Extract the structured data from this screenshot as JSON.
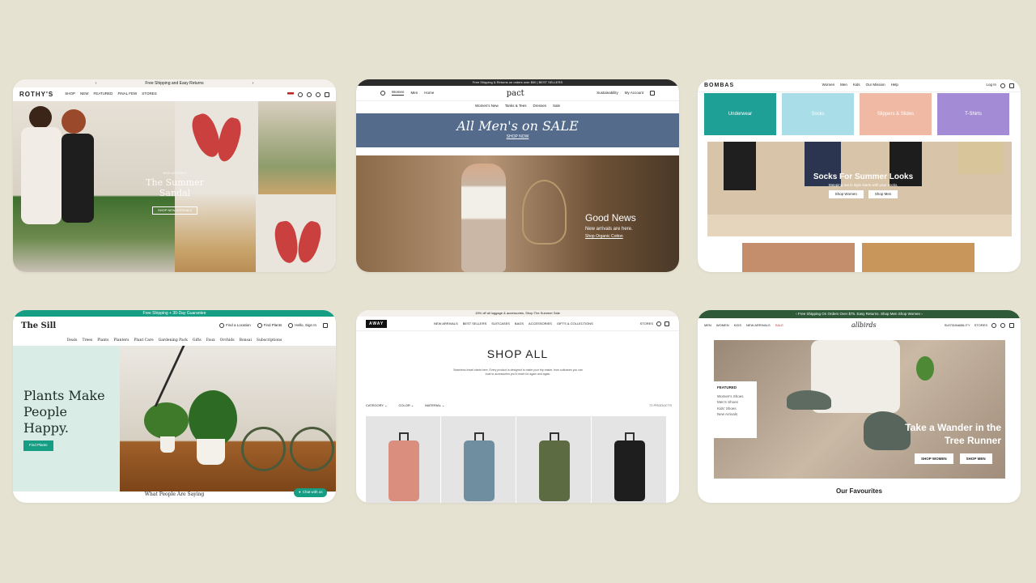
{
  "rothys": {
    "promo": "Free Shipping and Easy Returns",
    "logo": "ROTHY'S",
    "nav": [
      "SHOP",
      "NEW",
      "FEATURED",
      "FINAL FEW",
      "STORES"
    ],
    "eyebrow": "NEW ARRIVALS",
    "title": "The Summer Sandal",
    "cta": "SHOP NEW ARRIVALS"
  },
  "pact": {
    "promo": "Free Shipping & Returns on orders over $50 | BEST SELLERS",
    "logo": "pact",
    "nav": [
      "Women",
      "Men",
      "Home"
    ],
    "nav_right": [
      "Sustainability",
      "My Account"
    ],
    "subnav": [
      "Women's New",
      "Tanks & Tees",
      "Dresses",
      "Sale"
    ],
    "sale_title": "All Men's on SALE",
    "sale_cta": "SHOP NOW",
    "hero_title": "Good News",
    "hero_text": "New arrivals are here.",
    "hero_cta": "Shop Organic Cotton"
  },
  "bombas": {
    "logo": "BOMBAS",
    "nav": [
      "Women",
      "Men",
      "Kids",
      "Our Mission",
      "Help"
    ],
    "login": "Log In",
    "tiles": [
      "Underwear",
      "Socks",
      "Slippers & Slides",
      "T-Shirts"
    ],
    "hero_title": "Socks For Summer Looks",
    "hero_text": "Stepping out in style starts with your socks.",
    "btn_women": "Shop Women",
    "btn_men": "Shop Men"
  },
  "sill": {
    "promo": "Free Shipping + 30-Day Guarantee",
    "logo": "The Sill",
    "nav_right": [
      "Find a Location",
      "Find Plants",
      "Hello, Sign In"
    ],
    "subnav": [
      "Deals",
      "Trees",
      "Plants",
      "Planters",
      "Plant Care",
      "Gardening Pack",
      "Gifts",
      "Faux",
      "Orchids",
      "Bonsai",
      "Subscriptions"
    ],
    "headline": "Plants Make People Happy.",
    "cta": "Find Plants",
    "footer": "What People Are Saying",
    "chat": "Chat with us"
  },
  "away": {
    "promo": "15% off all luggage & accessories. Shop The Summer Sale",
    "logo": "AWAY",
    "nav": [
      "NEW ARRIVALS",
      "BEST SELLERS",
      "SUITCASES",
      "BAGS",
      "ACCESSORIES",
      "GIFTS & COLLECTIONS"
    ],
    "nav_right": [
      "STORES"
    ],
    "title": "SHOP ALL",
    "desc": "Seamless travel starts here. Every product is designed to make your trip easier, from suitcases you can trust to accessories you'll reach for again and again.",
    "filters": [
      "CATEGORY",
      "COLOR",
      "MATERIAL"
    ],
    "count": "72 PRODUCTS",
    "suitcase_colors": [
      "#d98e7e",
      "#6f8ea0",
      "#5d6b43",
      "#1e1e1e"
    ]
  },
  "allbirds": {
    "promo": "Free Shipping On Orders Over $75. Easy Returns. Shop Men  Shop Women",
    "nav": [
      "MEN",
      "WOMEN",
      "KIDS",
      "NEW ARRIVALS",
      "SALE"
    ],
    "logo": "allbirds",
    "nav_right": [
      "SUSTAINABILITY",
      "STORES"
    ],
    "featured_title": "FEATURED",
    "featured_links": [
      "Women's Shoes",
      "Men's Shoes",
      "Kids' Shoes",
      "New Arrivals"
    ],
    "tagline": "Take a Wander in the Tree Runner",
    "btn_women": "SHOP WOMEN",
    "btn_men": "SHOP MEN",
    "section_title": "Our Favourites"
  }
}
